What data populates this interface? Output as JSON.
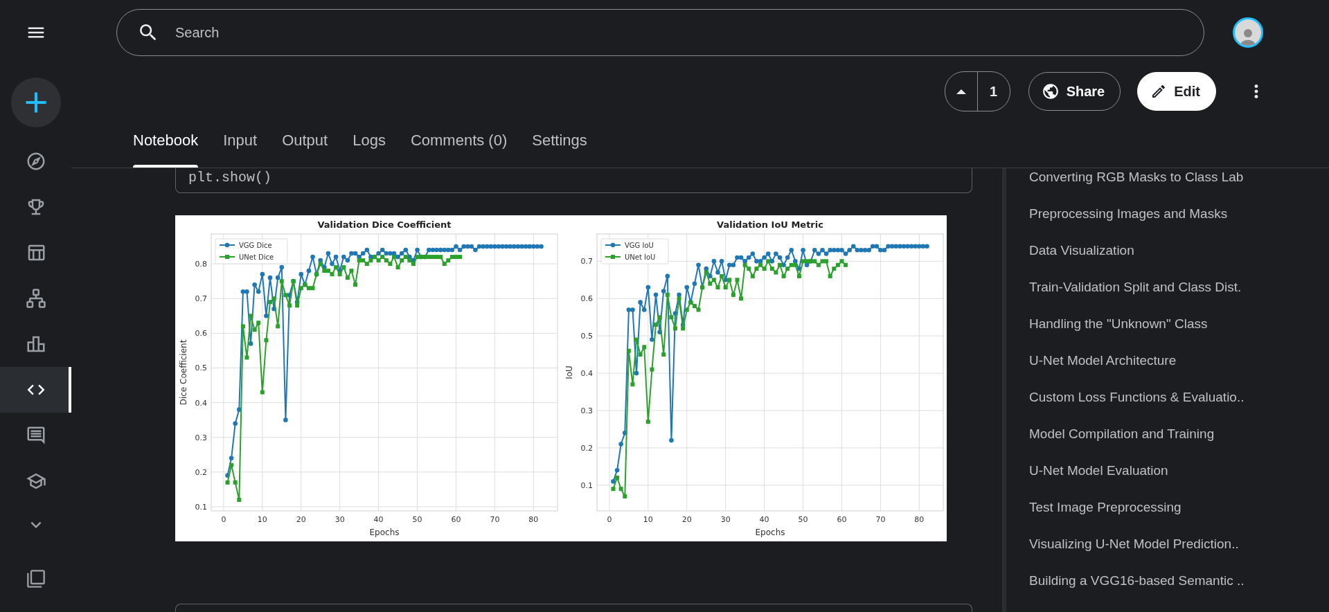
{
  "search": {
    "placeholder": "Search"
  },
  "vote": {
    "count": "1"
  },
  "actions": [
    {
      "kind": "share",
      "label": "Share"
    },
    {
      "kind": "edit",
      "label": "Edit"
    }
  ],
  "nav_items": [
    {
      "selected": false
    },
    {
      "selected": false
    },
    {
      "selected": false
    },
    {
      "selected": false
    },
    {
      "selected": false
    },
    {
      "selected": true
    },
    {
      "selected": false
    },
    {
      "selected": false
    }
  ],
  "tabs": [
    {
      "label": "Notebook",
      "selected": true
    },
    {
      "label": "Input",
      "selected": false
    },
    {
      "label": "Output",
      "selected": false
    },
    {
      "label": "Logs",
      "selected": false
    },
    {
      "label": "Comments (0)",
      "selected": false
    },
    {
      "label": "Settings",
      "selected": false
    }
  ],
  "code_cell": {
    "code": "plt.show()"
  },
  "output_figure": {
    "subplots": [
      {
        "chart_data": {
          "type": "line",
          "title": "Validation Dice Coefficient",
          "xlabel": "Epochs",
          "ylabel": "Dice Coefficient",
          "grid": true,
          "legend": true,
          "x": [
            1,
            2,
            3,
            4,
            5,
            6,
            7,
            8,
            9,
            10,
            11,
            12,
            13,
            14,
            15,
            16,
            17,
            18,
            19,
            20,
            21,
            22,
            23,
            24,
            25,
            26,
            27,
            28,
            29,
            30,
            31,
            32,
            33,
            34,
            35,
            36,
            37,
            38,
            39,
            40,
            41,
            42,
            43,
            44,
            45,
            46,
            47,
            48,
            49,
            50,
            51,
            52,
            53,
            54,
            55,
            56,
            57,
            58,
            59,
            60,
            61,
            62,
            63,
            64,
            65,
            66,
            67,
            68,
            69,
            70,
            71,
            72,
            73,
            74,
            75,
            76,
            77,
            78,
            79,
            80,
            81,
            82
          ],
          "xlim": [
            -3.2,
            86.2
          ],
          "ylim": [
            0.088,
            0.886
          ],
          "xticks": [
            0,
            10,
            20,
            30,
            40,
            50,
            60,
            70,
            80
          ],
          "yticks": [
            0.1,
            0.2,
            0.3,
            0.4,
            0.5,
            0.6,
            0.7,
            0.8
          ],
          "series": [
            {
              "name": "VGG Dice",
              "color": "#1f77b4",
              "marker": "o",
              "values": [
                0.19,
                0.24,
                0.34,
                0.38,
                0.72,
                0.72,
                0.57,
                0.74,
                0.72,
                0.77,
                0.65,
                0.76,
                0.67,
                0.76,
                0.79,
                0.35,
                0.71,
                0.75,
                0.69,
                0.77,
                0.74,
                0.78,
                0.82,
                0.77,
                0.81,
                0.79,
                0.83,
                0.8,
                0.82,
                0.78,
                0.82,
                0.81,
                0.83,
                0.83,
                0.82,
                0.83,
                0.84,
                0.82,
                0.82,
                0.83,
                0.84,
                0.83,
                0.83,
                0.83,
                0.82,
                0.83,
                0.84,
                0.82,
                0.81,
                0.84,
                0.82,
                0.82,
                0.84,
                0.84,
                0.84,
                0.84,
                0.84,
                0.84,
                0.84,
                0.85,
                0.84,
                0.85,
                0.85,
                0.85,
                0.84,
                0.85,
                0.85,
                0.85,
                0.85,
                0.85,
                0.85,
                0.85,
                0.85,
                0.85,
                0.85,
                0.85,
                0.85,
                0.85,
                0.85,
                0.85,
                0.85,
                0.85
              ]
            },
            {
              "name": "UNet Dice",
              "color": "#2ca02c",
              "marker": "s",
              "values": [
                0.17,
                0.22,
                0.17,
                0.12,
                0.62,
                0.53,
                0.65,
                0.61,
                0.63,
                0.43,
                0.58,
                0.69,
                0.7,
                0.62,
                0.75,
                0.71,
                0.68,
                0.75,
                0.68,
                0.73,
                0.74,
                0.73,
                0.73,
                0.77,
                0.8,
                0.78,
                0.78,
                0.77,
                0.79,
                0.77,
                0.79,
                0.76,
                0.78,
                0.74,
                0.81,
                0.81,
                0.8,
                0.81,
                0.82,
                0.81,
                0.82,
                0.81,
                0.8,
                0.82,
                0.79,
                0.81,
                0.82,
                0.81,
                0.8,
                0.82,
                0.82,
                0.82,
                0.82,
                0.82,
                0.82,
                0.82,
                0.8,
                0.81,
                0.82,
                0.82,
                0.82,
                null,
                null,
                null,
                null,
                null,
                null,
                null,
                null,
                null,
                null,
                null,
                null,
                null,
                null,
                null,
                null,
                null,
                null,
                null,
                null,
                null
              ]
            }
          ]
        }
      },
      {
        "chart_data": {
          "type": "line",
          "title": "Validation IoU Metric",
          "xlabel": "Epochs",
          "ylabel": "IoU",
          "grid": true,
          "legend": true,
          "x": [
            1,
            2,
            3,
            4,
            5,
            6,
            7,
            8,
            9,
            10,
            11,
            12,
            13,
            14,
            15,
            16,
            17,
            18,
            19,
            20,
            21,
            22,
            23,
            24,
            25,
            26,
            27,
            28,
            29,
            30,
            31,
            32,
            33,
            34,
            35,
            36,
            37,
            38,
            39,
            40,
            41,
            42,
            43,
            44,
            45,
            46,
            47,
            48,
            49,
            50,
            51,
            52,
            53,
            54,
            55,
            56,
            57,
            58,
            59,
            60,
            61,
            62,
            63,
            64,
            65,
            66,
            67,
            68,
            69,
            70,
            71,
            72,
            73,
            74,
            75,
            76,
            77,
            78,
            79,
            80,
            81,
            82
          ],
          "xlim": [
            -3.2,
            86.2
          ],
          "ylim": [
            0.031,
            0.773
          ],
          "xticks": [
            0,
            10,
            20,
            30,
            40,
            50,
            60,
            70,
            80
          ],
          "yticks": [
            0.1,
            0.2,
            0.3,
            0.4,
            0.5,
            0.6,
            0.7
          ],
          "series": [
            {
              "name": "VGG IoU",
              "color": "#1f77b4",
              "marker": "o",
              "values": [
                0.11,
                0.14,
                0.21,
                0.24,
                0.57,
                0.57,
                0.4,
                0.59,
                0.57,
                0.63,
                0.49,
                0.61,
                0.51,
                0.62,
                0.66,
                0.22,
                0.56,
                0.61,
                0.53,
                0.63,
                0.59,
                0.64,
                0.69,
                0.63,
                0.68,
                0.66,
                0.7,
                0.67,
                0.7,
                0.65,
                0.69,
                0.69,
                0.71,
                0.71,
                0.7,
                0.71,
                0.72,
                0.7,
                0.7,
                0.71,
                0.72,
                0.7,
                0.72,
                0.71,
                0.69,
                0.71,
                0.73,
                0.7,
                0.68,
                0.73,
                0.69,
                0.7,
                0.73,
                0.72,
                0.73,
                0.72,
                0.73,
                0.73,
                0.73,
                0.73,
                0.72,
                0.73,
                0.74,
                0.73,
                0.73,
                0.73,
                0.73,
                0.74,
                0.74,
                0.73,
                0.73,
                0.74,
                0.74,
                0.74,
                0.74,
                0.74,
                0.74,
                0.74,
                0.74,
                0.74,
                0.74,
                0.74
              ]
            },
            {
              "name": "UNet IoU",
              "color": "#2ca02c",
              "marker": "s",
              "values": [
                0.09,
                0.12,
                0.09,
                0.07,
                0.46,
                0.37,
                0.49,
                0.45,
                0.47,
                0.27,
                0.41,
                0.53,
                0.55,
                0.45,
                0.61,
                0.55,
                0.52,
                0.6,
                0.52,
                0.57,
                0.59,
                0.58,
                0.57,
                0.63,
                0.67,
                0.64,
                0.65,
                0.63,
                0.66,
                0.63,
                0.65,
                0.61,
                0.65,
                0.6,
                0.69,
                0.68,
                0.66,
                0.68,
                0.69,
                0.68,
                0.7,
                0.68,
                0.67,
                0.69,
                0.66,
                0.68,
                0.69,
                0.69,
                0.66,
                0.7,
                0.7,
                0.7,
                0.7,
                0.69,
                0.7,
                0.7,
                0.66,
                0.68,
                0.69,
                0.7,
                0.69,
                null,
                null,
                null,
                null,
                null,
                null,
                null,
                null,
                null,
                null,
                null,
                null,
                null,
                null,
                null,
                null,
                null,
                null,
                null,
                null,
                null
              ]
            }
          ]
        }
      }
    ]
  },
  "toc": {
    "items": [
      "Converting RGB Masks to Class Lab",
      "Preprocessing Images and Masks",
      "Data Visualization",
      "Train-Validation Split and Class Dist.",
      "Handling the \"Unknown\" Class",
      "U-Net Model Architecture",
      "Custom Loss Functions & Evaluatio..",
      "Model Compilation and Training",
      "U-Net Model Evaluation",
      "Test Image Preprocessing",
      "Visualizing U-Net Model Prediction..",
      "Building a VGG16-based Semantic .."
    ]
  }
}
